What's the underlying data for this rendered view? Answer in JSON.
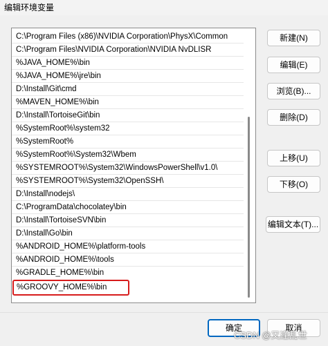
{
  "window": {
    "title": "编辑环境变量"
  },
  "entries": [
    "C:\\Program Files (x86)\\NVIDIA Corporation\\PhysX\\Common",
    "C:\\Program Files\\NVIDIA Corporation\\NVIDIA NvDLISR",
    "%JAVA_HOME%\\bin",
    "%JAVA_HOME%\\jre\\bin",
    "D:\\Install\\Git\\cmd",
    "%MAVEN_HOME%\\bin",
    "D:\\Install\\TortoiseGit\\bin",
    "%SystemRoot%\\system32",
    "%SystemRoot%",
    "%SystemRoot%\\System32\\Wbem",
    "%SYSTEMROOT%\\System32\\WindowsPowerShell\\v1.0\\",
    "%SYSTEMROOT%\\System32\\OpenSSH\\",
    "D:\\Install\\nodejs\\",
    "C:\\ProgramData\\chocolatey\\bin",
    "D:\\Install\\TortoiseSVN\\bin",
    "D:\\Install\\Go\\bin",
    "%ANDROID_HOME%\\platform-tools",
    "%ANDROID_HOME%\\tools",
    "%GRADLE_HOME%\\bin",
    "%GROOVY_HOME%\\bin"
  ],
  "selected_index": 19,
  "buttons": {
    "new": "新建(N)",
    "edit": "编辑(E)",
    "browse": "浏览(B)...",
    "delete": "删除(D)",
    "move_up": "上移(U)",
    "move_down": "下移(O)",
    "edit_text": "编辑文本(T)...",
    "ok": "确定",
    "cancel": "取消"
  },
  "watermark": "CSDN @又逢乱世",
  "colors": {
    "selection_outline": "#d71b1b",
    "ok_border": "#0067c0"
  }
}
